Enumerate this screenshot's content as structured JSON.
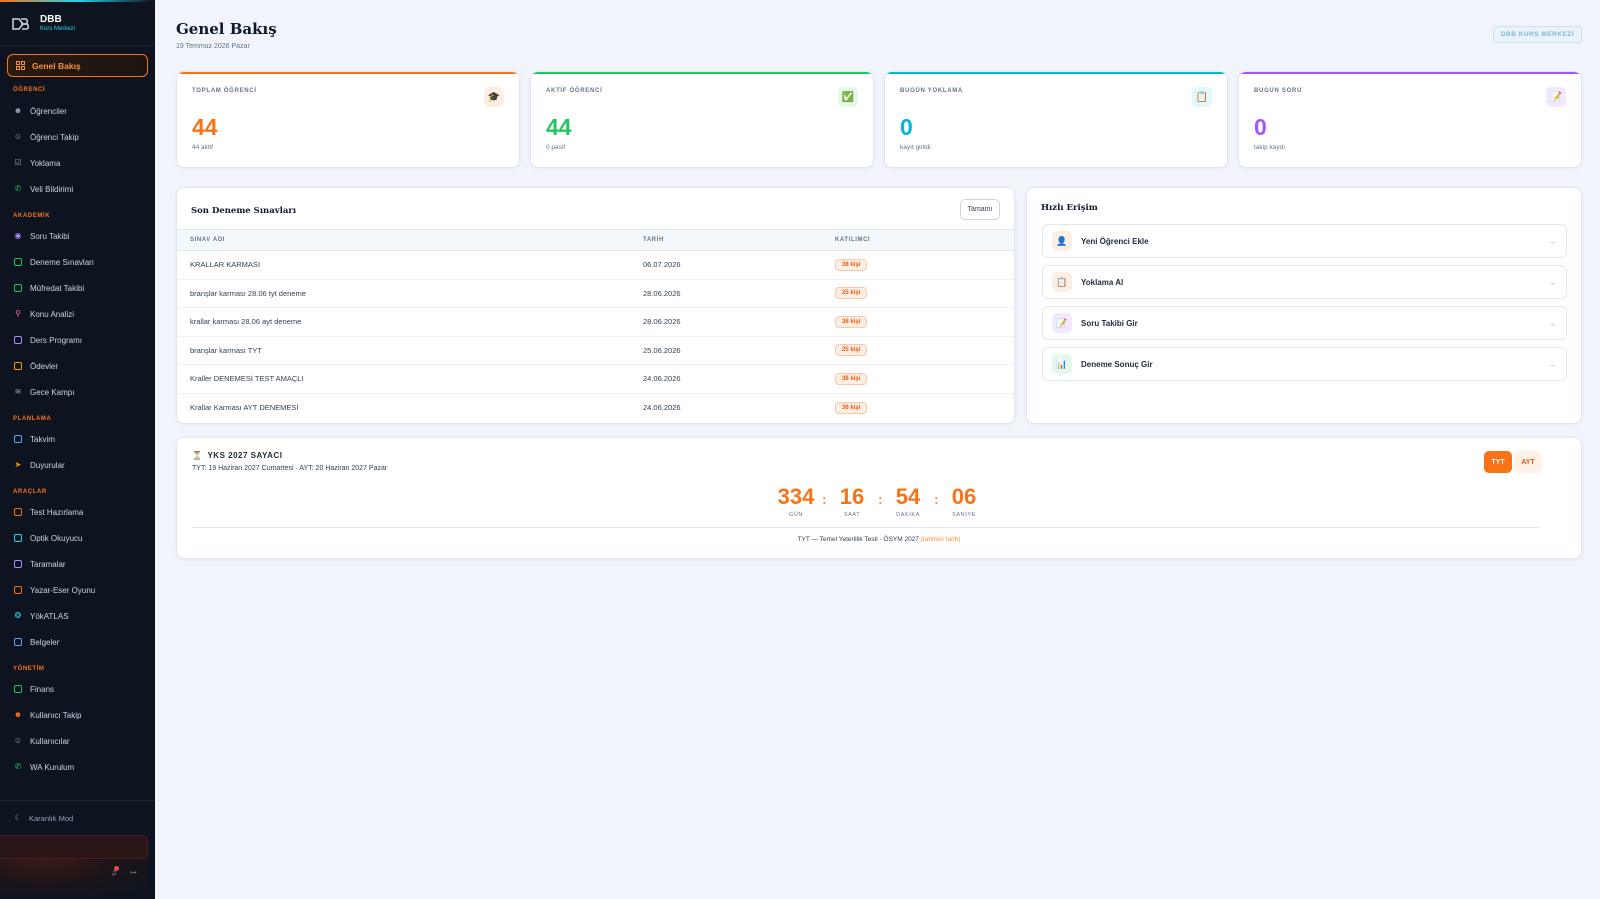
{
  "brand": {
    "name": "DBB",
    "subtitle": "Kurs Merkezi"
  },
  "colors": {
    "accent": "#f97316",
    "green": "#22c55e",
    "cyan": "#06b6d4",
    "purple": "#a855f7",
    "sidebar_bg": "#0e1320"
  },
  "sidebar": {
    "active": {
      "label": "Genel Bakış",
      "icon": "grid-icon"
    },
    "sections": [
      {
        "title": "ÖĞRENCİ",
        "items": [
          {
            "label": "Öğrenciler",
            "icon": "user-icon"
          },
          {
            "label": "Öğrenci Takip",
            "icon": "users-icon"
          },
          {
            "label": "Yoklama",
            "icon": "check-square-icon"
          },
          {
            "label": "Veli Bildirimi",
            "icon": "whatsapp-icon"
          }
        ]
      },
      {
        "title": "AKADEMİK",
        "items": [
          {
            "label": "Soru Takibi",
            "icon": "gauge-icon"
          },
          {
            "label": "Deneme Sınavları",
            "icon": "document-icon"
          },
          {
            "label": "Müfredat Takibi",
            "icon": "book-icon"
          },
          {
            "label": "Konu Analizi",
            "icon": "magnifier-icon"
          },
          {
            "label": "Ders Programı",
            "icon": "calendar-grid-icon"
          },
          {
            "label": "Ödevler",
            "icon": "clipboard-icon"
          },
          {
            "label": "Gece Kampı",
            "icon": "chart-icon"
          }
        ]
      },
      {
        "title": "PLANLAMA",
        "items": [
          {
            "label": "Takvim",
            "icon": "calendar-icon"
          },
          {
            "label": "Duyurular",
            "icon": "megaphone-icon"
          }
        ]
      },
      {
        "title": "ARAÇLAR",
        "items": [
          {
            "label": "Test Hazırlama",
            "icon": "file-edit-icon"
          },
          {
            "label": "Optik Okuyucu",
            "icon": "scanner-icon"
          },
          {
            "label": "Taramalar",
            "icon": "scan-icon"
          },
          {
            "label": "Yazar-Eser Oyunu",
            "icon": "gamepad-icon"
          },
          {
            "label": "YökATLAS",
            "icon": "compass-icon"
          },
          {
            "label": "Belgeler",
            "icon": "file-icon"
          }
        ]
      },
      {
        "title": "YÖNETİM",
        "items": [
          {
            "label": "Finans",
            "icon": "wallet-icon"
          },
          {
            "label": "Kullanıcı Takip",
            "icon": "user-track-icon"
          },
          {
            "label": "Kullanıcılar",
            "icon": "users-icon"
          },
          {
            "label": "WA Kurulum",
            "icon": "whatsapp-icon"
          }
        ]
      }
    ],
    "dark_mode": "Karanlık Mod"
  },
  "header": {
    "title": "Genel Bakış",
    "date": "19 Temmuz 2026 Pazar",
    "badge": "DBB KURS MERKEZİ"
  },
  "stats": [
    {
      "label": "TOPLAM ÖĞRENCİ",
      "value": "44",
      "sub": "44 aktif",
      "icon": "🎓",
      "color": "#f97316",
      "icon_bg": "#fdeee4"
    },
    {
      "label": "AKTİF ÖĞRENCİ",
      "value": "44",
      "sub": "0 pasif",
      "icon": "✅",
      "color": "#22c55e",
      "icon_bg": "#e6f7ec"
    },
    {
      "label": "BUGÜN YOKLAMA",
      "value": "0",
      "sub": "kayıt girildi",
      "icon": "📋",
      "color": "#06b6d4",
      "icon_bg": "#e3f6fa"
    },
    {
      "label": "BUGÜN SORU",
      "value": "0",
      "sub": "takip kaydı",
      "icon": "📝",
      "color": "#a855f7",
      "icon_bg": "#f3e8fd"
    }
  ],
  "exams": {
    "title": "Son Deneme Sınavları",
    "all_label": "Tamamı",
    "columns": [
      "SINAV ADI",
      "TARİH",
      "KATILIMCI"
    ],
    "rows": [
      {
        "name": "KRALLAR KARMASI",
        "date": "06.07.2026",
        "count": "36 kişi"
      },
      {
        "name": "branşlar karması 28.06 tyt deneme",
        "date": "28.06.2026",
        "count": "25 kişi"
      },
      {
        "name": "krallar karması 28.06 ayt deneme",
        "date": "28.06.2026",
        "count": "36 kişi"
      },
      {
        "name": "branşlar karması TYT",
        "date": "25.06.2026",
        "count": "25 kişi"
      },
      {
        "name": "Kraller DENEMESİ TEST AMAÇLI",
        "date": "24.06.2026",
        "count": "36 kişi"
      },
      {
        "name": "Krallar Karması AYT DENEMESİ",
        "date": "24.06.2026",
        "count": "36 kişi"
      }
    ]
  },
  "quick_access": {
    "title": "Hızlı Erişim",
    "arrow": "→",
    "items": [
      {
        "label": "Yeni Öğrenci Ekle",
        "icon": "👤",
        "icon_bg": "#fdeee4"
      },
      {
        "label": "Yoklama Al",
        "icon": "📋",
        "icon_bg": "#fdeee4"
      },
      {
        "label": "Soru Takibi Gir",
        "icon": "📝",
        "icon_bg": "#f3e8fd"
      },
      {
        "label": "Deneme Sonuç Gir",
        "icon": "📊",
        "icon_bg": "#e6f7ec"
      }
    ]
  },
  "countdown": {
    "icon": "⏳",
    "title": "YKS 2027 SAYACI",
    "subtitle": "TYT: 19 Haziran 2027 Cumartesi · AYT: 20 Haziran 2027 Pazar",
    "tabs": [
      "TYT",
      "AYT"
    ],
    "units": [
      {
        "value": "334",
        "label": "GÜN"
      },
      {
        "value": "16",
        "label": "SAAT"
      },
      {
        "value": "54",
        "label": "DAKİKA"
      },
      {
        "value": "06",
        "label": "SANİYE"
      }
    ],
    "separator": ":",
    "footer": "TYT — Temel Yeterlilik Testi · ÖSYM 2027",
    "footer_hint": "(tahmini tarih)"
  }
}
